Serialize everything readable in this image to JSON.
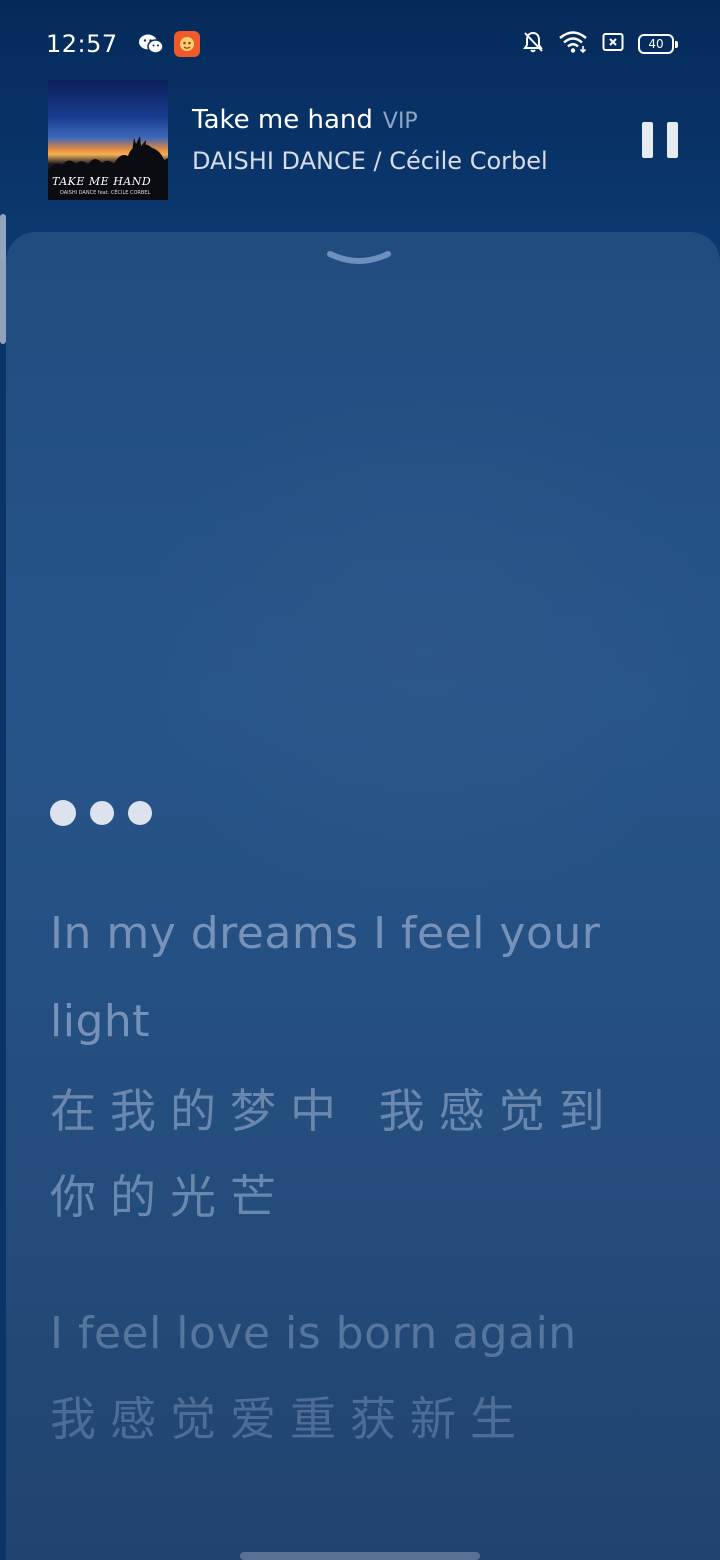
{
  "status_bar": {
    "time": "12:57",
    "battery": "40",
    "icons": [
      "wechat-icon",
      "app-notification-icon",
      "bell-muted-icon",
      "wifi-icon",
      "sim-icon",
      "battery-icon"
    ]
  },
  "player": {
    "title": "Take me hand",
    "badge": "VIP",
    "artist": "DAISHI DANCE / Cécile Corbel",
    "album_art_text": "TAKE ME HAND",
    "album_art_subtext": "DAISHI DANCE feat. CÉCILE CORBEL"
  },
  "lyrics": [
    {
      "en": "In my dreams I feel your light",
      "zh": "在我的梦中 我感觉到你的光芒"
    },
    {
      "en": "I feel love is born again",
      "zh": "我感觉爱重获新生"
    }
  ],
  "colors": {
    "background": "#0b3468",
    "sheet": "#244d7d",
    "lyric_dim": "#96acd0"
  }
}
